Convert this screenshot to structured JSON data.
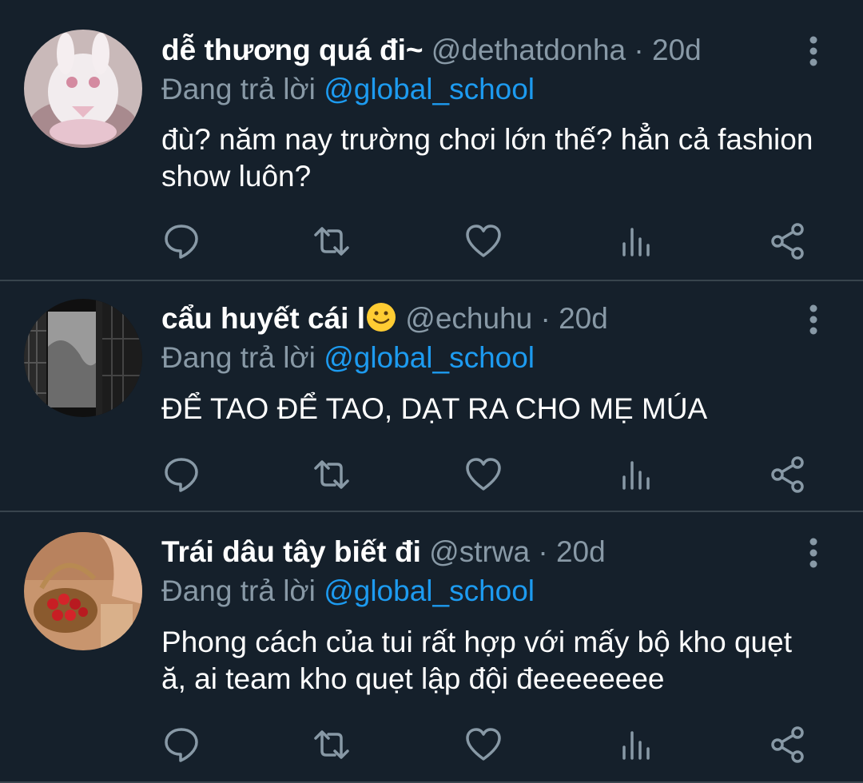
{
  "colors": {
    "background": "#15202b",
    "divider": "#38444d",
    "secondary_text": "#8899a6",
    "mention": "#1d9bf0",
    "primary_text": "#ffffff"
  },
  "tweets": [
    {
      "display_name": "dễ thương quá đi~",
      "meta": " @dethatdonha · 20d",
      "replying_label": "Đang trả lời ",
      "mention": "@global_school",
      "body": "đù? năm nay trường chơi lớn thế? hẳn cả fashion show luôn?"
    },
    {
      "display_name": "cẩu huyết cái l",
      "emoji": "slightly-smiling-face",
      "meta": " @echuhu · 20d",
      "replying_label": "Đang trả lời ",
      "mention": "@global_school",
      "body": "ĐỂ TAO ĐỂ TAO, DẠT RA CHO MẸ MÚA"
    },
    {
      "display_name": "Trái dâu tây biết đi",
      "meta": " @strwa · 20d",
      "replying_label": "Đang trả lời ",
      "mention": "@global_school",
      "body": "Phong cách của tui rất hợp với mấy bộ kho quẹt ă, ai team kho quẹt lập đội đeeeeeeee"
    }
  ],
  "icons": {
    "reply": "reply-icon",
    "retweet": "retweet-icon",
    "like": "heart-icon",
    "analytics": "analytics-icon",
    "share": "share-icon",
    "more": "more-vertical-icon"
  }
}
